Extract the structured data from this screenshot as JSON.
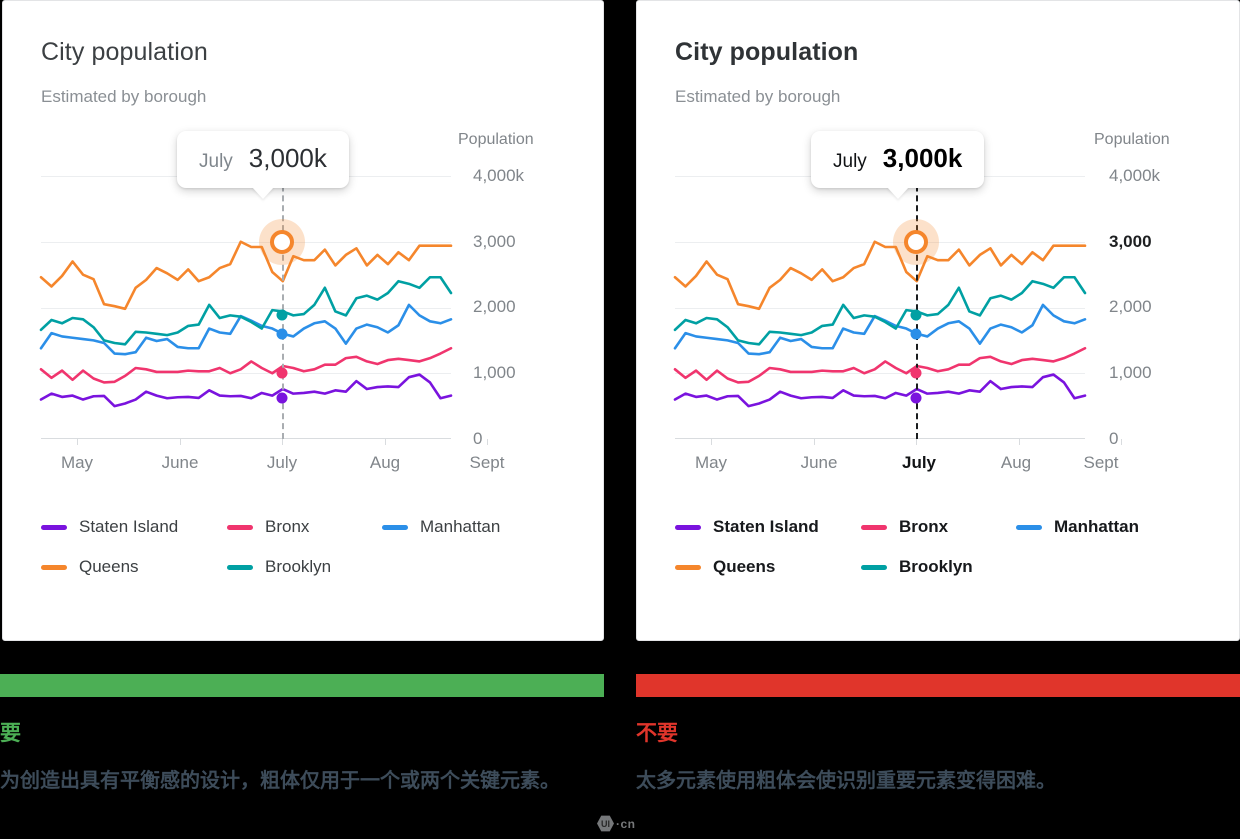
{
  "panels": [
    {
      "id": "do",
      "title": "City population",
      "subtitle": "Estimated by borough",
      "y_axis_legend": "Population",
      "tooltip": {
        "month": "July",
        "value": "3,000k"
      },
      "emphasis": "none"
    },
    {
      "id": "dont",
      "title": "City population",
      "subtitle": "Estimated by borough",
      "y_axis_legend": "Population",
      "tooltip": {
        "month": "July",
        "value": "3,000k"
      },
      "emphasis": "all-bold"
    }
  ],
  "captions": {
    "do": {
      "verdict": "要",
      "body": "为创造出具有平衡感的设计，粗体仅用于一个或两个关键元素。",
      "rule_color": "#4caf55"
    },
    "dont": {
      "verdict": "不要",
      "body": "太多元素使用粗体会使识别重要元素变得困难。",
      "rule_color": "#e0352b"
    }
  },
  "watermark": {
    "mark": "UI",
    "text": "·cn"
  },
  "chart_data": {
    "type": "line",
    "title": "City population",
    "subtitle": "Estimated by borough",
    "xlabel": "",
    "ylabel": "Population",
    "ylim": [
      0,
      4000
    ],
    "yticks": [
      0,
      1000,
      2000,
      3000,
      4000
    ],
    "ytick_labels": [
      "0",
      "1,000",
      "2,000",
      "3,000",
      "4,000k"
    ],
    "grid": true,
    "legend_position": "bottom-left",
    "categories": [
      "May",
      "June",
      "July",
      "Aug",
      "Sept"
    ],
    "highlight": {
      "x": "July",
      "series": "Queens",
      "value": 3000,
      "label": "3,000k"
    },
    "series": [
      {
        "name": "Staten Island",
        "color": "#7a13de",
        "marker_value": 620,
        "values": [
          600,
          690,
          640,
          660,
          600,
          650,
          655,
          500,
          540,
          600,
          720,
          660,
          620,
          635,
          640,
          625,
          740,
          660,
          650,
          655,
          620,
          700,
          660,
          760,
          690,
          700,
          720,
          690,
          740,
          720,
          880,
          760,
          790,
          800,
          790,
          940,
          980,
          860,
          620,
          660
        ]
      },
      {
        "name": "Bronx",
        "color": "#f0356e",
        "marker_value": 1000,
        "values": [
          1060,
          930,
          1040,
          900,
          1040,
          920,
          860,
          870,
          960,
          1080,
          1060,
          1020,
          1020,
          1020,
          1040,
          1030,
          1030,
          1080,
          1000,
          1060,
          1180,
          1080,
          1000,
          1110,
          1080,
          1030,
          1060,
          1130,
          1130,
          1230,
          1250,
          1180,
          1140,
          1200,
          1220,
          1200,
          1180,
          1230,
          1300,
          1380
        ]
      },
      {
        "name": "Manhattan",
        "color": "#2b8fe8",
        "marker_value": 1600,
        "values": [
          1380,
          1610,
          1560,
          1540,
          1520,
          1500,
          1460,
          1300,
          1290,
          1320,
          1540,
          1490,
          1520,
          1400,
          1380,
          1380,
          1680,
          1620,
          1600,
          1870,
          1800,
          1720,
          1680,
          1600,
          1560,
          1680,
          1760,
          1790,
          1680,
          1450,
          1680,
          1740,
          1700,
          1620,
          1730,
          2040,
          1880,
          1790,
          1760,
          1820
        ]
      },
      {
        "name": "Queens",
        "color": "#f5862c",
        "marker_value": 3000,
        "values": [
          2460,
          2320,
          2480,
          2700,
          2500,
          2430,
          2050,
          2020,
          1980,
          2300,
          2420,
          2600,
          2520,
          2420,
          2580,
          2400,
          2460,
          2600,
          2660,
          3000,
          2920,
          2920,
          2540,
          2400,
          2780,
          2720,
          2720,
          2880,
          2640,
          2800,
          2900,
          2640,
          2800,
          2660,
          2840,
          2720,
          2940,
          2940,
          2940,
          2940
        ]
      },
      {
        "name": "Brooklyn",
        "color": "#00a0a3",
        "marker_value": 1880,
        "values": [
          1660,
          1810,
          1760,
          1840,
          1820,
          1700,
          1500,
          1460,
          1440,
          1630,
          1620,
          1600,
          1580,
          1620,
          1720,
          1740,
          2040,
          1840,
          1880,
          1860,
          1780,
          1680,
          1960,
          1940,
          1880,
          1900,
          2040,
          2300,
          1940,
          1880,
          2140,
          2180,
          2120,
          2220,
          2400,
          2360,
          2300,
          2460,
          2460,
          2220
        ]
      }
    ]
  }
}
